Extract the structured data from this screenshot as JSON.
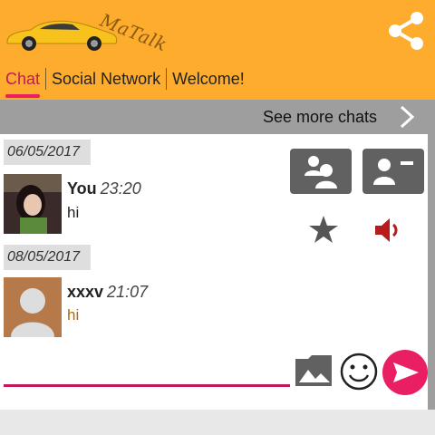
{
  "app": {
    "logo_text": "MaTalk"
  },
  "header": {
    "tabs": [
      {
        "label": "Chat",
        "active": true
      },
      {
        "label": "Social Network",
        "active": false
      },
      {
        "label": "Welcome!",
        "active": false
      }
    ]
  },
  "see_more": {
    "label": "See more chats"
  },
  "messages": [
    {
      "date": "06/05/2017",
      "name": "You",
      "time": "23:20",
      "text": "hi",
      "text_color": "#222222"
    },
    {
      "date": "08/05/2017",
      "name": "xxxv",
      "time": "21:07",
      "text": "hi",
      "text_color": "#b36b00"
    }
  ],
  "composer": {
    "value": "",
    "placeholder": ""
  },
  "colors": {
    "header": "#FDAC2D",
    "accent": "#e91e63",
    "see_more_bar": "#9e9e9e",
    "action_button": "#616161",
    "speaker": "#b71c1c"
  },
  "icons": {
    "share": "share-icon",
    "more": "chevron-right-icon",
    "group": "group-icon",
    "contact": "contact-card-icon",
    "star": "star-icon",
    "speaker": "speaker-icon",
    "gallery": "gallery-icon",
    "emoji": "emoji-icon",
    "send": "send-icon"
  }
}
